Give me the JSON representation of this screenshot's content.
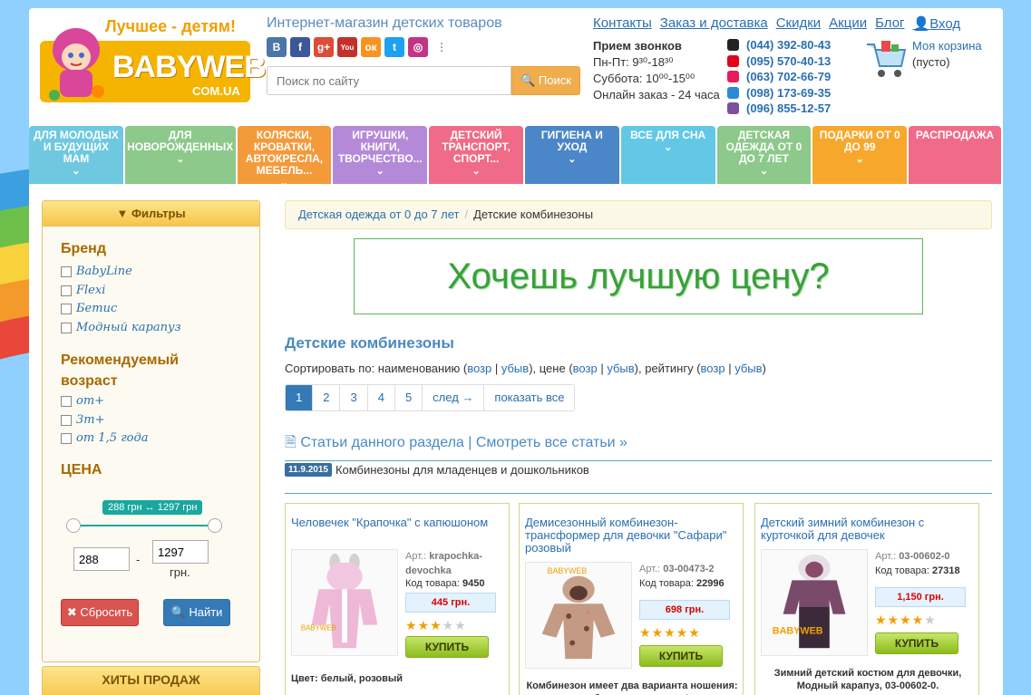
{
  "header": {
    "slogan": "Лучшее - детям!",
    "logo_text": "BABYWEB",
    "logo_sub": "COM.UA",
    "shop_title": "Интернет-магазин детских товаров",
    "search_placeholder": "Поиск по сайту",
    "search_button": "Поиск",
    "links": [
      "Контакты",
      "Заказ и доставка",
      "Скидки",
      "Акции",
      "Блог",
      "Вход"
    ],
    "hours": {
      "title": "Прием звонков",
      "weekdays": "Пн-Пт: 9³⁰-18³⁰",
      "saturday": "Суббота: 10⁰⁰-15⁰⁰",
      "online": "Онлайн заказ - 24 часа"
    },
    "phones": [
      "(044) 392-80-43",
      "(095) 570-40-13",
      "(063) 702-66-79",
      "(098) 173-69-35",
      "(096) 855-12-57"
    ],
    "cart_title": "Моя корзина",
    "cart_status": "(пусто)"
  },
  "nav": [
    {
      "label": "Для молодых и будущих мам",
      "color": "#6ec9e0"
    },
    {
      "label": "Для новорожденных",
      "color": "#8cc98a"
    },
    {
      "label": "Коляски, кроватки, автокресла, мебель...",
      "color": "#f39a3a"
    },
    {
      "label": "Игрушки, книги, творчество...",
      "color": "#b48ad8"
    },
    {
      "label": "Детский транспорт, спорт...",
      "color": "#ef6b87"
    },
    {
      "label": "Гигиена и уход",
      "color": "#4a86c8"
    },
    {
      "label": "Все для сна",
      "color": "#62c8e6"
    },
    {
      "label": "Детская одежда от 0 до 7 лет",
      "color": "#8cc98a"
    },
    {
      "label": "Подарки от 0 до 99",
      "color": "#f7a82c"
    },
    {
      "label": "Распродажа",
      "color": "#ef6b87"
    }
  ],
  "filters": {
    "title": "Фильтры",
    "brand_title": "Бренд",
    "brands": [
      "BabyLine",
      "Flexi",
      "Бетис",
      "Модный карапуз"
    ],
    "age_title": "Рекомендуемый возраст",
    "ages": [
      "от+",
      "3т+",
      "от 1,5 года"
    ],
    "price_title": "ЦЕНА",
    "price_range": "288 грн ↔ 1297 грн",
    "price_min": "288",
    "price_max": "1297",
    "currency": "грн.",
    "reset": "Сбросить",
    "find": "Найти",
    "hits": "ХИТЫ ПРОДАЖ"
  },
  "breadcrumb": [
    "Детская одежда от 0 до 7 лет",
    "Детские комбинезоны"
  ],
  "banner": "Хочешь лучшую цену?",
  "category_title": "Детские комбинезоны",
  "sort": {
    "prefix": "Сортировать по:",
    "name": "наименованию",
    "price": "цене",
    "rating": "рейтингу",
    "asc": "возр",
    "desc": "убыв"
  },
  "pager": [
    "1",
    "2",
    "3",
    "4",
    "5",
    "след →",
    "показать все"
  ],
  "articles": {
    "head": "Статьи данного раздела | Смотреть все статьи »",
    "date": "11.9.2015",
    "title": "Комбинезоны для младенцев и дошкольников"
  },
  "products": [
    {
      "title": "Человечек \"Крапочка\" с капюшоном",
      "art": "krapochka-devochka",
      "code": "9450",
      "price": "445 грн.",
      "stars": 3,
      "buy": "КУПИТЬ",
      "desc": "Цвет: белый, розовый"
    },
    {
      "title": "Демисезонный комбинезон-трансформер для девочки \"Сафари\" розовый",
      "art": "03-00473-2",
      "code": "22996",
      "price": "698 грн.",
      "stars": 5,
      "buy": "КУПИТЬ",
      "desc": "Комбинезон имеет два варианта ношения: комбинезон и конверт!"
    },
    {
      "title": "Детский зимний комбинезон с курточкой для девочек",
      "art": "03-00602-0",
      "code": "27318",
      "price": "1,150 грн.",
      "stars": 4,
      "buy": "КУПИТЬ",
      "desc": "Зимний детский костюм для девочки, Модный карапуз, 03-00602-0."
    }
  ],
  "labels": {
    "art": "Арт.:",
    "code": "Код товара:",
    "color_label": "Цвет:"
  }
}
